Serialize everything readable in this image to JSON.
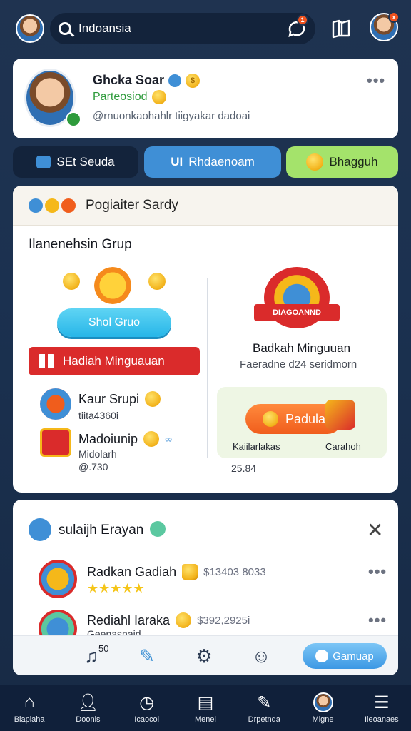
{
  "topbar": {
    "search_text": "Indoansia",
    "chat_badge": "1",
    "profile_badge": "x"
  },
  "profile": {
    "name": "Ghcka Soar",
    "status": "Parteosiod",
    "handle": "@rnuonkaohahlr tiigyakar dadoai",
    "more": "•••"
  },
  "tabs": [
    {
      "label": "SEt Seuda"
    },
    {
      "label": "Rhdaenoam",
      "prefix": "UI"
    },
    {
      "label": "Bhagguh"
    }
  ],
  "group_panel": {
    "header_title": "Pogiaiter Sardy",
    "group_title": "Ilanenehsin Grup",
    "shop_button": "Shol Gruo",
    "gift_button": "Hadiah Minguauan",
    "items": [
      {
        "name": "Kaur Srupi",
        "sub": "tiita4360i"
      },
      {
        "name": "Madoiunip",
        "sub": "Midolarh",
        "value": "@.730"
      }
    ],
    "prize": {
      "badge_text": "DIAGOANND",
      "title": "Badkah Minguuan",
      "sub": "Faeradne d24 seridmorn"
    },
    "prize_box": {
      "button": "Padula",
      "left_label": "Kaiilarlakas",
      "right_label": "Carahoh",
      "value": "25.84"
    }
  },
  "lower_panel": {
    "title": "sulaijh Erayan",
    "rows": [
      {
        "name": "Radkan Gadiah",
        "price": "$13403 8033",
        "stars": "★★★★★"
      },
      {
        "name": "Rediahl Iaraka",
        "price": "$392,2925i",
        "sub": "Geenasnaid"
      }
    ],
    "action_value": "50",
    "game_button": "Gamuap"
  },
  "bottom_nav": [
    {
      "label": "Biapiaha",
      "icon": "home-icon"
    },
    {
      "label": "Doonis",
      "icon": "person-icon"
    },
    {
      "label": "Icaocol",
      "icon": "clock-icon"
    },
    {
      "label": "Menei",
      "icon": "clipboard-icon"
    },
    {
      "label": "Drpetnda",
      "icon": "edit-icon"
    },
    {
      "label": "Migne",
      "icon": "avatar-icon"
    },
    {
      "label": "Ileoanaes",
      "icon": "menu-icon"
    }
  ],
  "colors": {
    "background": "#1f3350",
    "accent_blue": "#3f8fd6",
    "accent_green": "#a4e36b",
    "red": "#da2b2b",
    "orange": "#f05d1c"
  }
}
